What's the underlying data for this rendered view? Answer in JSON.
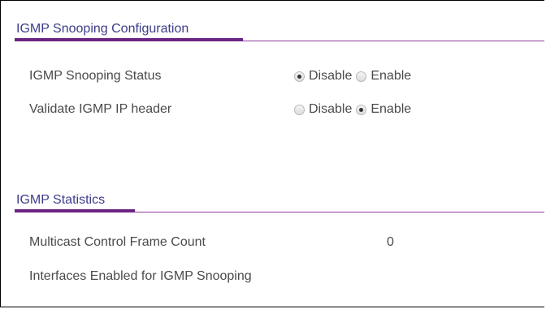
{
  "config": {
    "title": "IGMP Snooping Configuration",
    "rows": [
      {
        "label": "IGMP Snooping Status",
        "options": [
          "Disable",
          "Enable"
        ],
        "selected": "Disable"
      },
      {
        "label": "Validate IGMP IP header",
        "options": [
          "Disable",
          "Enable"
        ],
        "selected": "Enable"
      }
    ]
  },
  "stats": {
    "title": "IGMP Statistics",
    "rows": [
      {
        "label": "Multicast Control Frame Count",
        "value": "0"
      },
      {
        "label": "Interfaces Enabled for IGMP Snooping",
        "value": ""
      }
    ]
  },
  "colors": {
    "accent": "#6c2483",
    "title_text": "#3c3c8a"
  }
}
